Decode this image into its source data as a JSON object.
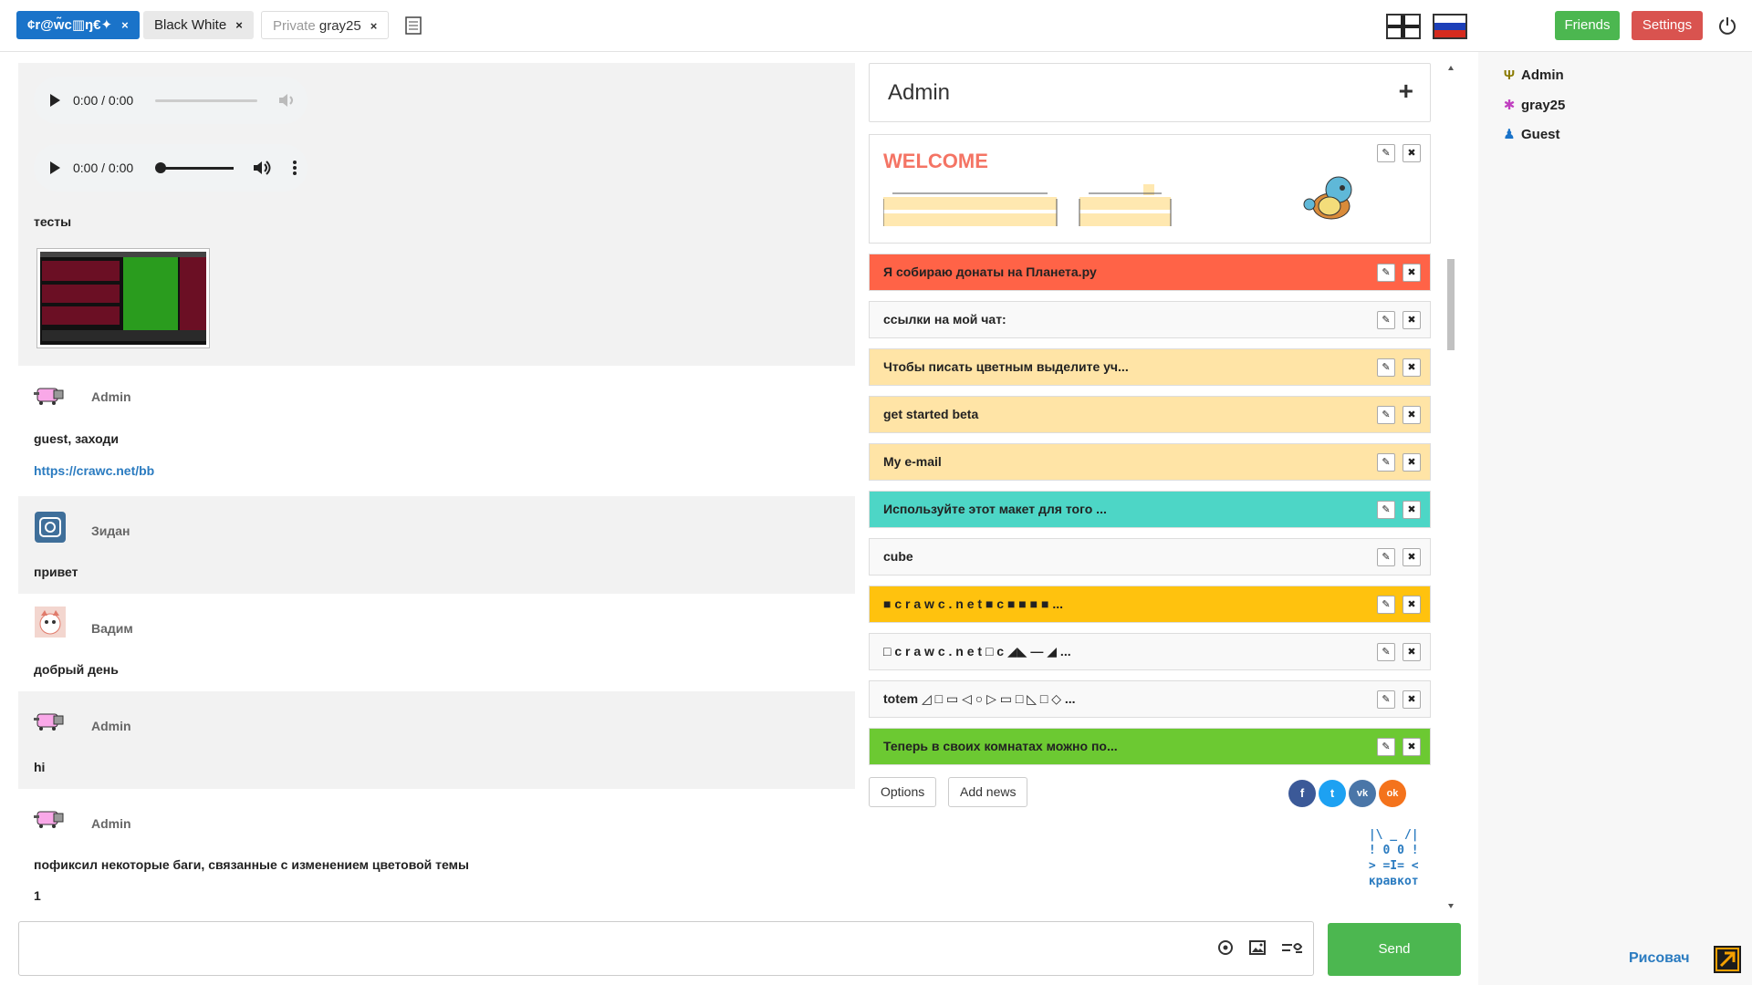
{
  "tabs": [
    {
      "label": "¢r@w̃c▥ŋ€✦"
    },
    {
      "label": "Black White"
    },
    {
      "prefix": "Private",
      "label": "gray25"
    }
  ],
  "tab_close": "×",
  "header": {
    "friends": "Friends",
    "settings": "Settings"
  },
  "chat": {
    "audio1_time": "0:00 / 0:00",
    "audio2_time": "0:00 / 0:00",
    "test_text": "тесты",
    "messages": [
      {
        "author": "Admin",
        "text": "guest, заходи",
        "link": "https://crawc.net/bb"
      },
      {
        "author": "Зидан",
        "text": "привет"
      },
      {
        "author": "Вадим",
        "text": "добрый день"
      },
      {
        "author": "Admin",
        "text": "hi"
      },
      {
        "author": "Admin",
        "text": "пофиксил некоторые баги, связанные с изменением цветовой темы",
        "extra": "1"
      }
    ]
  },
  "panel": {
    "title": "Admin",
    "add": "+",
    "welcome": "WELCOME",
    "news": [
      {
        "text": "Я собираю донаты на Планета.ру",
        "color": "#ff6347"
      },
      {
        "text": "ссылки на мой чат:",
        "color": "#f9f9f9"
      },
      {
        "text": "Чтобы писать цветным выделите уч...",
        "color": "#ffe4a6"
      },
      {
        "text": "get started beta",
        "color": "#ffe4a6"
      },
      {
        "text": "My e-mail",
        "color": "#ffe4a6"
      },
      {
        "text": "Используйте этот макет для того ...",
        "color": "#4dd6c6"
      },
      {
        "text": "cube",
        "color": "#f9f9f9"
      },
      {
        "text": "■ c r a w c . n e t ■ c ■ ■ ■ ■ ...",
        "color": "#ffc20e"
      },
      {
        "text": "□ c r a w c . n e t □ c ◢◣ — ◢ ...",
        "color": "#f9f9f9"
      },
      {
        "text": "totem ◿ □ ▭ ◁ ○ ▷ ▭ □ ◺ □ ◇ ...",
        "color": "#f9f9f9"
      },
      {
        "text": "Теперь в своих комнатах можно по...",
        "color": "#6cc932"
      }
    ],
    "edit_icon": "✎",
    "delete_icon": "✖",
    "options": "Options",
    "add_news": "Add news",
    "social": [
      {
        "name": "facebook",
        "glyph": "f",
        "color": "#3b5998"
      },
      {
        "name": "twitter",
        "glyph": "t",
        "color": "#1da1f2"
      },
      {
        "name": "vk",
        "glyph": "vk",
        "color": "#4a76a8"
      },
      {
        "name": "odnoklassniki",
        "glyph": "ok",
        "color": "#f4731c"
      }
    ],
    "ascii_cat": " |\\ _ /|\n ! 0 0 !\n > =I= <\n кравкот"
  },
  "users": [
    {
      "name": "Admin",
      "icon": "Ψ",
      "color": "#8a7a00"
    },
    {
      "name": "gray25",
      "icon": "✱",
      "color": "#c040c0"
    },
    {
      "name": "Guest",
      "icon": "♟",
      "color": "#1a73c9"
    }
  ],
  "risovach": "Рисовач",
  "input": {
    "send": "Send"
  }
}
